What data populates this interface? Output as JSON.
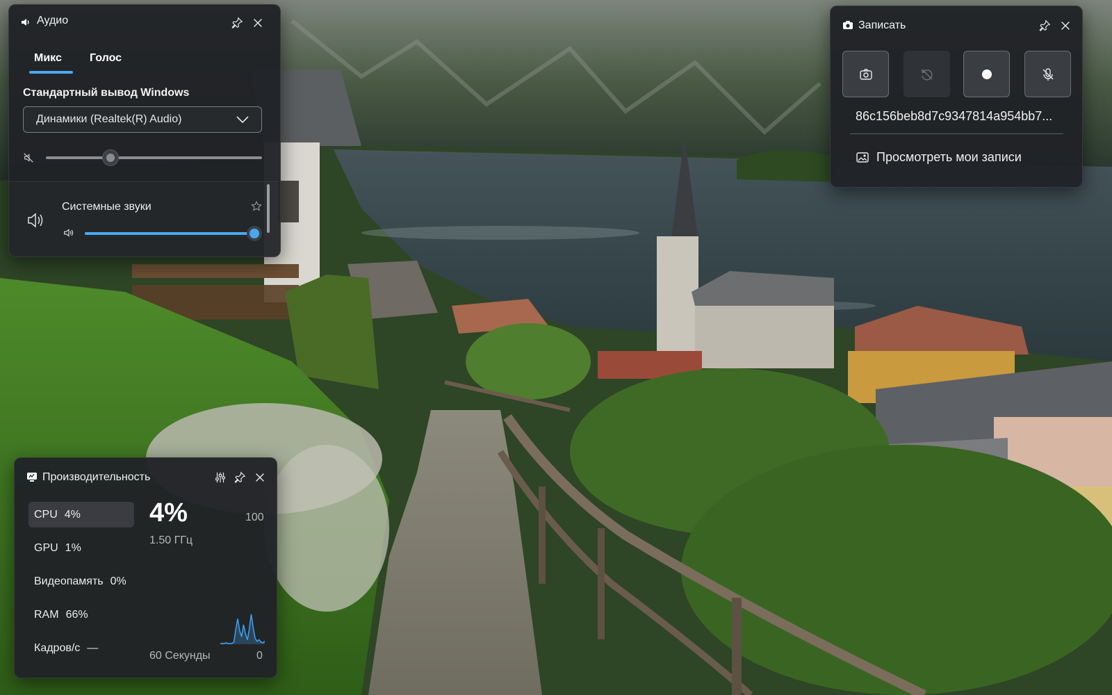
{
  "audio": {
    "title": "Аудио",
    "tabs": [
      {
        "label": "Микс"
      },
      {
        "label": "Голос"
      }
    ],
    "section_title": "Стандартный вывод Windows",
    "output_device": "Динамики (Realtek(R) Audio)",
    "master_volume": 0.3,
    "system_sounds": {
      "label": "Системные звуки",
      "volume": 1.0
    }
  },
  "record": {
    "title": "Записать",
    "buttons": [
      {
        "name": "screenshot",
        "state": "active"
      },
      {
        "name": "record-last",
        "state": "disabled"
      },
      {
        "name": "start-recording",
        "state": "active"
      },
      {
        "name": "microphone",
        "state": "active"
      }
    ],
    "file_name": "86c156beb8d7c9347814a954bb7...",
    "view_recordings_label": "Просмотреть мои записи"
  },
  "performance": {
    "title": "Производительность",
    "metrics": [
      {
        "label": "CPU",
        "value": "4%",
        "selected": true
      },
      {
        "label": "GPU",
        "value": "1%"
      },
      {
        "label": "Видеопамять",
        "value": "0%"
      },
      {
        "label": "RAM",
        "value": "66%"
      },
      {
        "label": "Кадров/с",
        "value": "—"
      }
    ],
    "current_value": "4%",
    "frequency": "1.50 ГГц",
    "scale_max": "100",
    "scale_min": "0",
    "time_window": "60 Секунды",
    "graph_values": [
      1,
      1,
      1,
      2,
      1,
      1,
      1,
      3,
      20,
      34,
      18,
      10,
      26,
      14,
      6,
      20,
      40,
      22,
      8,
      4,
      6,
      3,
      2,
      4
    ]
  },
  "colors": {
    "accent": "#4aa7f1",
    "panel_bg": "#202226"
  }
}
